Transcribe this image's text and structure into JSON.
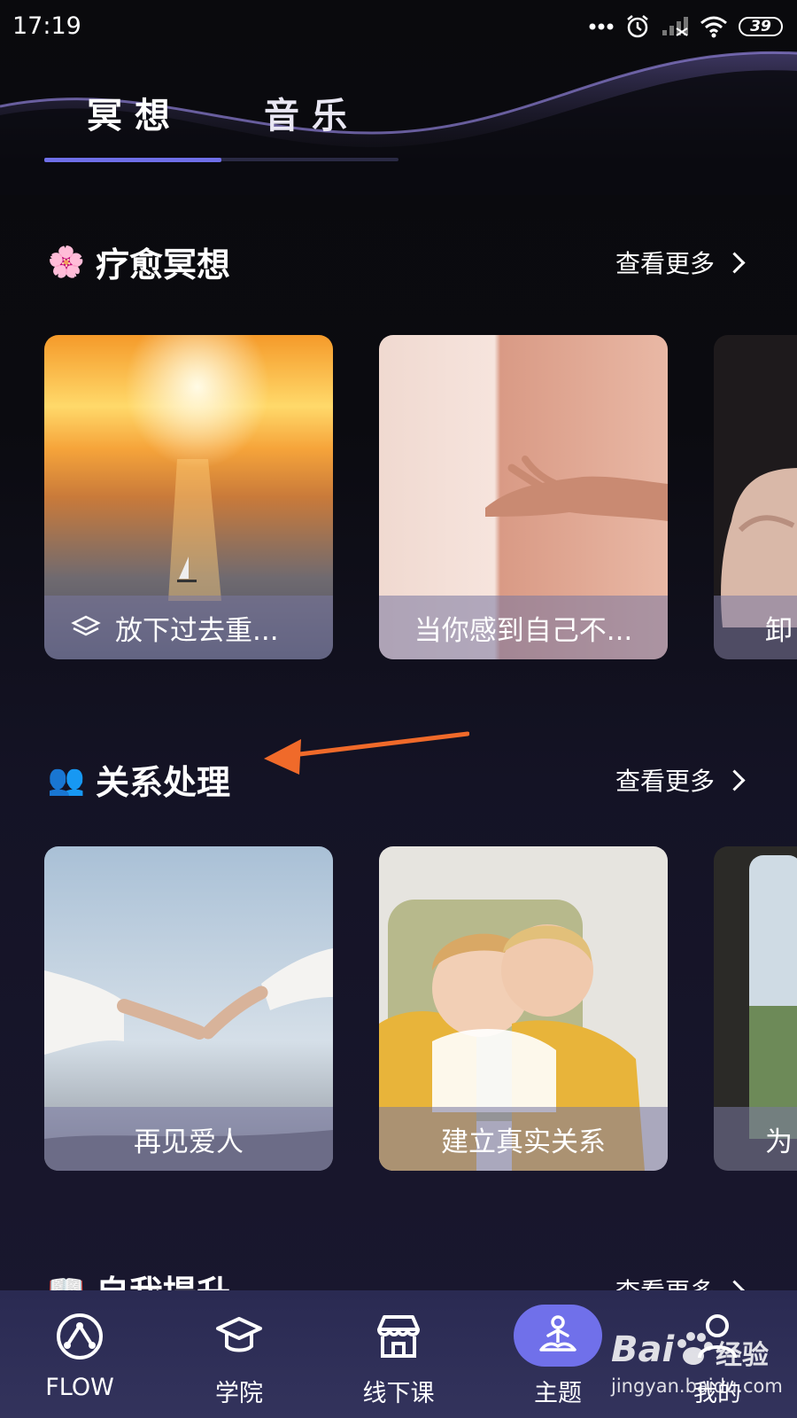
{
  "status_bar": {
    "time": "17:19",
    "battery": "39"
  },
  "tabs": [
    {
      "label": "冥想"
    },
    {
      "label": "音乐"
    }
  ],
  "sections": [
    {
      "emoji": "🌸",
      "title": "疗愈冥想",
      "more": "查看更多",
      "cards": [
        {
          "caption": "放下过去重..."
        },
        {
          "caption": "当你感到自己不..."
        },
        {
          "caption": "卸"
        }
      ]
    },
    {
      "emoji": "👥",
      "title": "关系处理",
      "more": "查看更多",
      "cards": [
        {
          "caption": "再见爱人"
        },
        {
          "caption": "建立真实关系"
        },
        {
          "caption": "为"
        }
      ]
    },
    {
      "emoji": "📖",
      "title": "自我提升",
      "more": "查看更多"
    }
  ],
  "bottom_nav": [
    {
      "label": "FLOW",
      "icon": "flow-icon"
    },
    {
      "label": "学院",
      "icon": "graduation-cap-icon"
    },
    {
      "label": "线下课",
      "icon": "store-icon"
    },
    {
      "label": "主题",
      "icon": "meditation-icon",
      "active": true
    },
    {
      "label": "我的",
      "icon": "user-icon"
    }
  ],
  "watermark": {
    "brand": "Bai",
    "suffix": "经验",
    "url": "jingyan.baidu.com"
  },
  "colors": {
    "accent": "#6f6fe8",
    "nav_active": "#7070ea",
    "arrow": "#f06a2a"
  }
}
